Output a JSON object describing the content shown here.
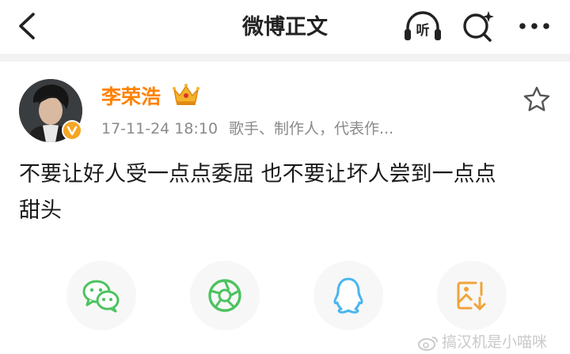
{
  "header": {
    "title": "微博正文",
    "listen_label": "听"
  },
  "post": {
    "author": "李荣浩",
    "timestamp": "17-11-24 18:10",
    "author_desc": "歌手、制作人，代表作...",
    "text_line1": "不要让好人受一点点委屈 也不要让坏人尝到一点点",
    "text_line2": "甜头"
  },
  "share": {
    "items": [
      "wechat-icon",
      "moments-icon",
      "qq-icon",
      "save-image-icon"
    ]
  },
  "watermark": {
    "text": "搞汉机是小喵咪"
  },
  "colors": {
    "accent": "#ff8200",
    "verified": "#f6a623",
    "wechat": "#4cc35f",
    "qq": "#4ab5f0"
  }
}
